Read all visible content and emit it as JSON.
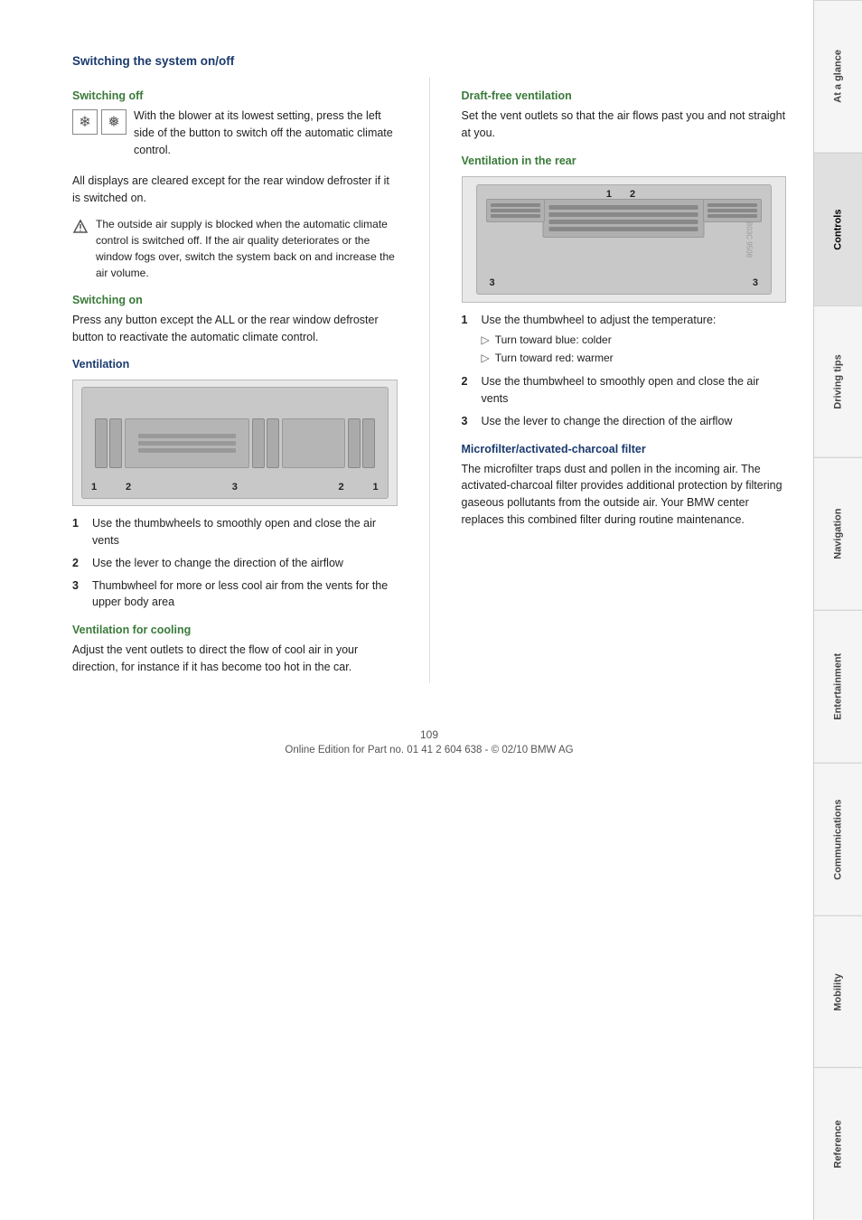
{
  "sidebar": {
    "items": [
      {
        "label": "At a glance",
        "active": false
      },
      {
        "label": "Controls",
        "active": true
      },
      {
        "label": "Driving tips",
        "active": false
      },
      {
        "label": "Navigation",
        "active": false
      },
      {
        "label": "Entertainment",
        "active": false
      },
      {
        "label": "Communications",
        "active": false
      },
      {
        "label": "Mobility",
        "active": false
      },
      {
        "label": "Reference",
        "active": false
      }
    ]
  },
  "page": {
    "number": "109",
    "footer": "Online Edition for Part no. 01 41 2 604 638 - © 02/10 BMW AG"
  },
  "left_column": {
    "main_title": "Switching the system on/off",
    "switching_off": {
      "title": "Switching off",
      "text1": "With the blower at its lowest setting, press the left side of the button to switch off the automatic climate control.",
      "text2": "All displays are cleared except for the rear window defroster if it is switched on.",
      "note": "The outside air supply is blocked when the automatic climate control is switched off. If the air quality deteriorates or the window fogs over, switch the system back on and increase the air volume."
    },
    "switching_on": {
      "title": "Switching on",
      "text": "Press any button except the ALL or the rear window defroster button to reactivate the automatic climate control."
    },
    "ventilation": {
      "title": "Ventilation",
      "items": [
        {
          "num": "1",
          "text": "Use the thumbwheels to smoothly open and close the air vents"
        },
        {
          "num": "2",
          "text": "Use the lever to change the direction of the airflow"
        },
        {
          "num": "3",
          "text": "Thumbwheel for more or less cool air from the vents for the upper body area"
        }
      ],
      "diagram_labels": [
        "1",
        "2",
        "3",
        "2",
        "1"
      ]
    },
    "ventilation_for_cooling": {
      "title": "Ventilation for cooling",
      "text": "Adjust the vent outlets to direct the flow of cool air in your direction, for instance if it has become too hot in the car."
    }
  },
  "right_column": {
    "draft_free": {
      "title": "Draft-free ventilation",
      "text": "Set the vent outlets so that the air flows past you and not straight at you."
    },
    "ventilation_rear": {
      "title": "Ventilation in the rear",
      "items": [
        {
          "num": "1",
          "text": "Use the thumbwheel to adjust the temperature:",
          "sub": [
            "Turn toward blue: colder",
            "Turn toward red: warmer"
          ]
        },
        {
          "num": "2",
          "text": "Use the thumbwheel to smoothly open and close the air vents"
        },
        {
          "num": "3",
          "text": "Use the lever to change the direction of the airflow"
        }
      ],
      "diagram_labels": [
        "1",
        "2",
        "3",
        "3"
      ]
    },
    "microfilter": {
      "title": "Microfilter/activated-charcoal filter",
      "text": "The microfilter traps dust and pollen in the incoming air. The activated-charcoal filter provides additional protection by filtering gaseous pollutants from the outside air. Your BMW center replaces this combined filter during routine maintenance."
    }
  }
}
